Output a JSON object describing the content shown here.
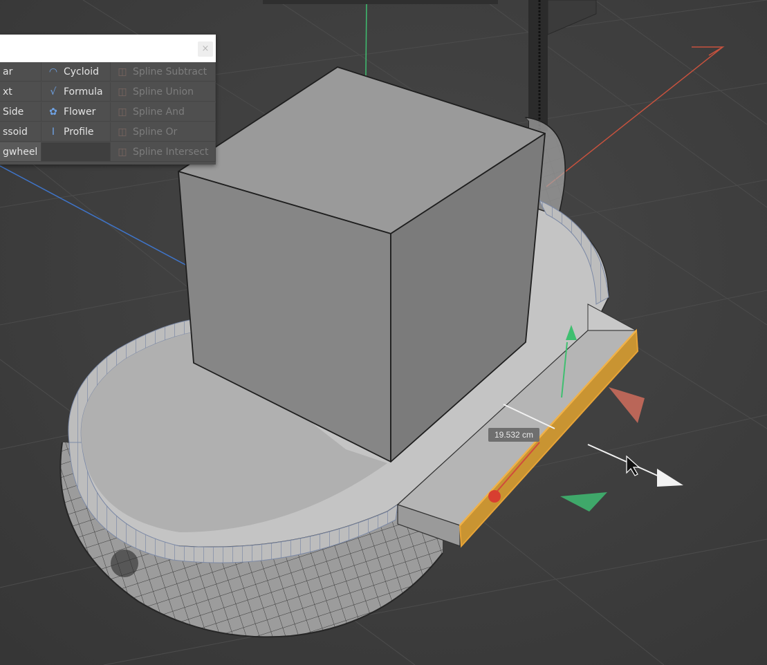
{
  "palette": {
    "close_glyph": "×",
    "col1": [
      "ar",
      "xt",
      "Side",
      "ssoid",
      "gwheel"
    ],
    "col2": [
      {
        "label": "Cycloid",
        "icon": "cycloid-icon",
        "glyph": "◠"
      },
      {
        "label": "Formula",
        "icon": "formula-icon",
        "glyph": "√"
      },
      {
        "label": "Flower",
        "icon": "flower-icon",
        "glyph": "✿"
      },
      {
        "label": "Profile",
        "icon": "profile-icon",
        "glyph": "I"
      }
    ],
    "col3": [
      {
        "label": "Spline Subtract",
        "icon": "spline-subtract-icon",
        "glyph": "◫"
      },
      {
        "label": "Spline Union",
        "icon": "spline-union-icon",
        "glyph": "◫"
      },
      {
        "label": "Spline And",
        "icon": "spline-and-icon",
        "glyph": "◫"
      },
      {
        "label": "Spline Or",
        "icon": "spline-or-icon",
        "glyph": "◫"
      },
      {
        "label": "Spline Intersect",
        "icon": "spline-intersect-icon",
        "glyph": "◫"
      }
    ]
  },
  "measurement": {
    "value": "19.532 cm"
  },
  "colors": {
    "x_axis": "#c8523e",
    "y_axis": "#3fbf70",
    "z_axis": "#3f74c8",
    "selection": "#e8a437",
    "spline_icon": "#6fa3e6",
    "viewport_bg": "#3e3e3e"
  }
}
